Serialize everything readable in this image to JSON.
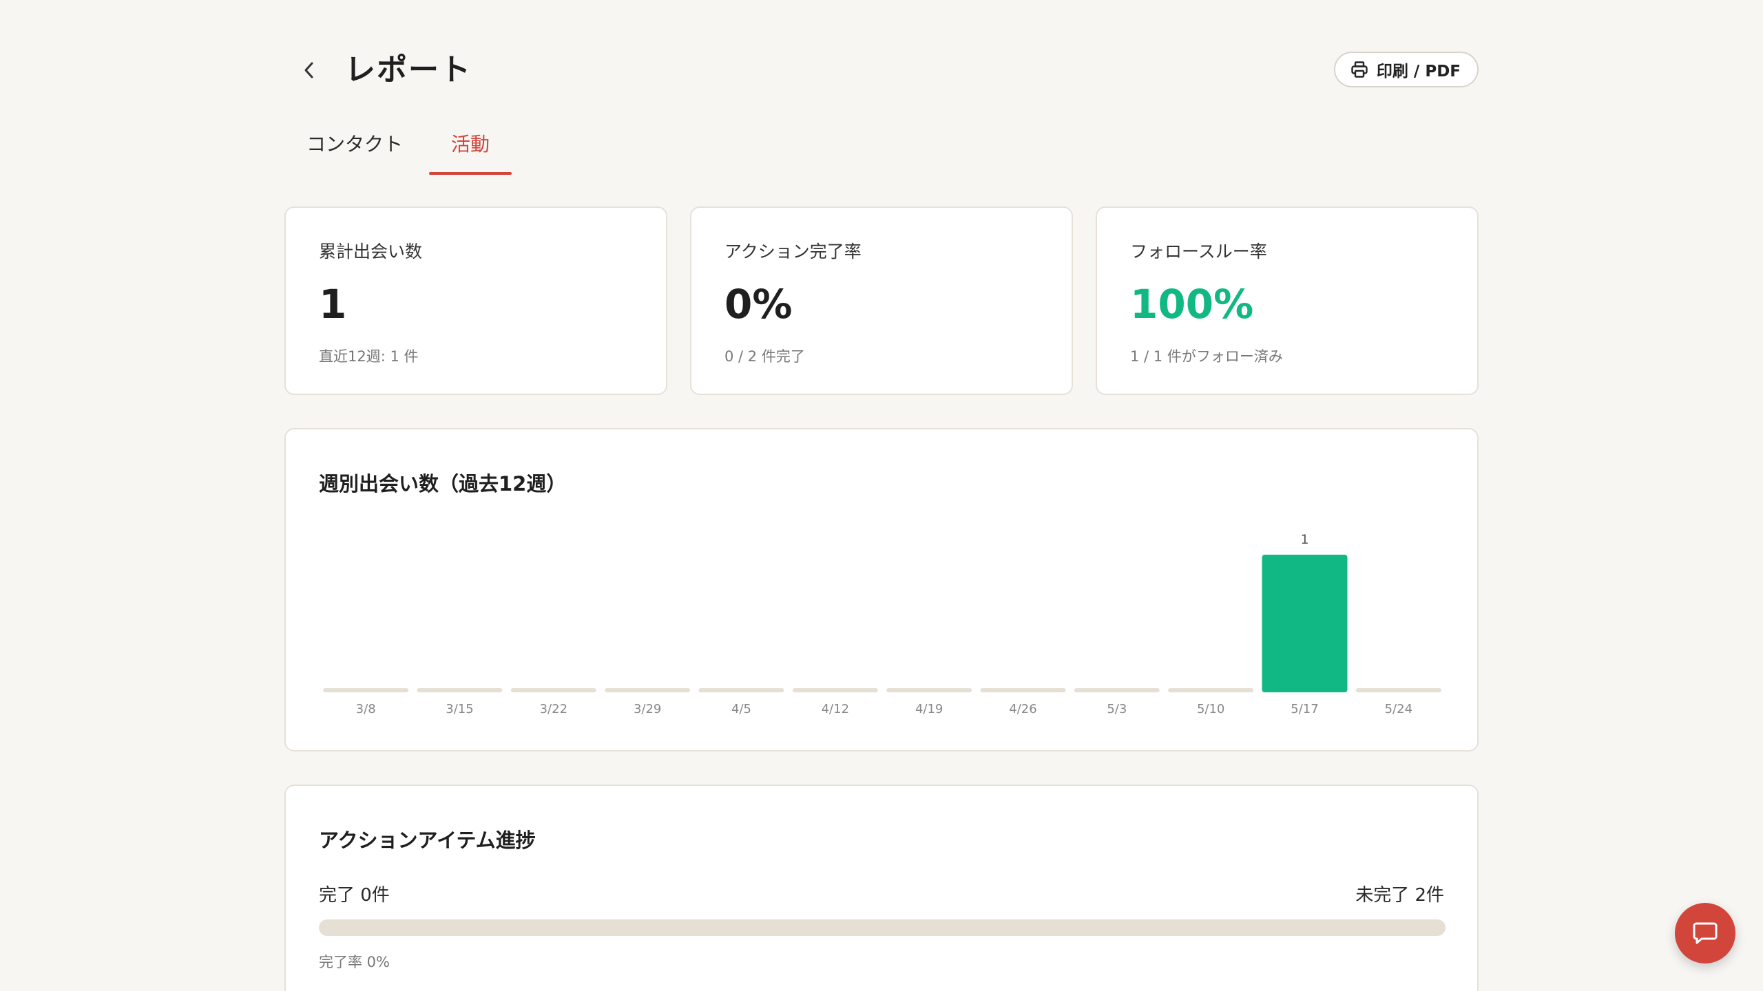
{
  "header": {
    "title": "レポート",
    "print_label": "印刷 / PDF"
  },
  "tabs": [
    {
      "label": "コンタクト",
      "active": false
    },
    {
      "label": "活動",
      "active": true
    }
  ],
  "stats": [
    {
      "label": "累計出会い数",
      "value": "1",
      "sub": "直近12週: 1 件"
    },
    {
      "label": "アクション完了率",
      "value": "0%",
      "sub": "0 / 2 件完了"
    },
    {
      "label": "フォロースルー率",
      "value": "100%",
      "sub": "1 / 1 件がフォロー済み"
    }
  ],
  "weekly": {
    "title": "週別出会い数（過去12週）"
  },
  "chart_data": {
    "type": "bar",
    "categories": [
      "3/8",
      "3/15",
      "3/22",
      "3/29",
      "4/5",
      "4/12",
      "4/19",
      "4/26",
      "5/3",
      "5/10",
      "5/17",
      "5/24"
    ],
    "values": [
      0,
      0,
      0,
      0,
      0,
      0,
      0,
      0,
      0,
      0,
      1,
      0
    ],
    "data_labels": [
      "",
      "",
      "",
      "",
      "",
      "",
      "",
      "",
      "",
      "",
      "1",
      ""
    ],
    "ylim": [
      0,
      1
    ],
    "grid": false,
    "bar_color": "#12b883",
    "empty_color": "#e6e0d4"
  },
  "progress": {
    "title": "アクションアイテム進捗",
    "done_label": "完了 0件",
    "todo_label": "未完了 2件",
    "rate_label": "完了率 0%",
    "fraction": 0
  },
  "colors": {
    "accent": "#d2453b",
    "positive": "#12b883"
  },
  "icons": {
    "back": "chevron-left-icon",
    "print": "printer-icon",
    "chat": "chat-bubble-icon"
  }
}
